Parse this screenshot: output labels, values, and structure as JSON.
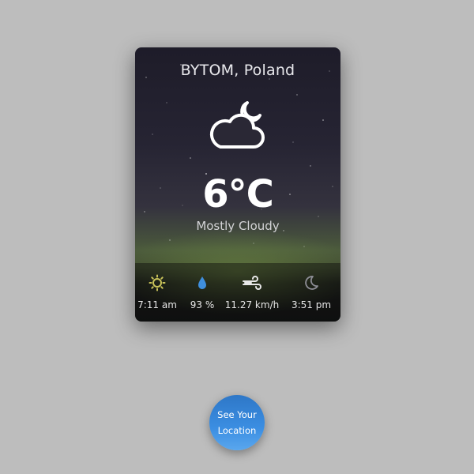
{
  "location": {
    "title": "BYTOM, Poland"
  },
  "weather": {
    "icon": "cloud-moon-icon",
    "temperature": "6°C",
    "description": "Mostly Cloudy"
  },
  "stats": [
    {
      "icon": "sun-icon",
      "value": "7:11 am",
      "color": "#c9c35a"
    },
    {
      "icon": "humidity-drop-icon",
      "value": "93 %",
      "color": "#3f8fde"
    },
    {
      "icon": "wind-icon",
      "value": "11.27 km/h",
      "color": "#e8e8e8"
    },
    {
      "icon": "moon-icon",
      "value": "3:51 pm",
      "color": "#8e8e96"
    }
  ],
  "button": {
    "label": "See Your Location"
  },
  "colors": {
    "background": "#bdbdbd",
    "button": "#3b8ee2"
  }
}
